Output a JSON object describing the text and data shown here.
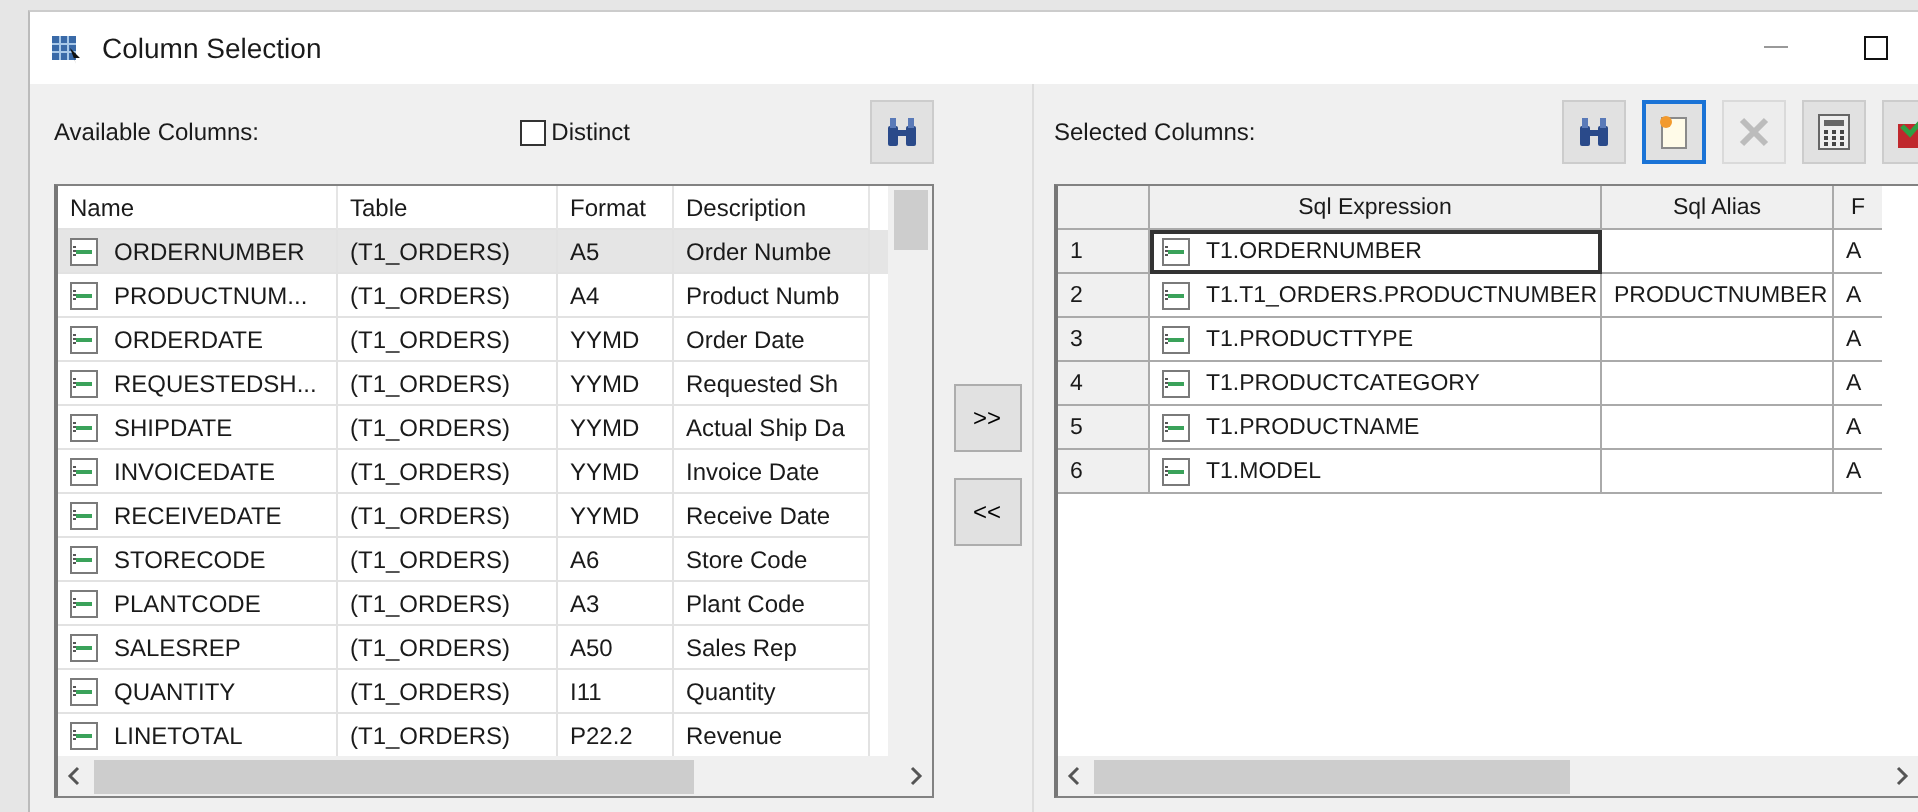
{
  "window": {
    "title": "Column Selection"
  },
  "available": {
    "label": "Available Columns:",
    "distinct": {
      "label": "Distinct",
      "checked": false
    },
    "columns": [
      "Name",
      "Table",
      "Format",
      "Description"
    ],
    "rows": [
      {
        "name": "ORDERNUMBER",
        "table": "(T1_ORDERS)",
        "format": "A5",
        "description": "Order Numbe",
        "selected": true
      },
      {
        "name": "PRODUCTNUM...",
        "table": "(T1_ORDERS)",
        "format": "A4",
        "description": "Product Numb",
        "selected": false
      },
      {
        "name": "ORDERDATE",
        "table": "(T1_ORDERS)",
        "format": "YYMD",
        "description": "Order Date",
        "selected": false
      },
      {
        "name": "REQUESTEDSH...",
        "table": "(T1_ORDERS)",
        "format": "YYMD",
        "description": "Requested Sh",
        "selected": false
      },
      {
        "name": "SHIPDATE",
        "table": "(T1_ORDERS)",
        "format": "YYMD",
        "description": "Actual Ship Da",
        "selected": false
      },
      {
        "name": "INVOICEDATE",
        "table": "(T1_ORDERS)",
        "format": "YYMD",
        "description": "Invoice Date",
        "selected": false
      },
      {
        "name": "RECEIVEDATE",
        "table": "(T1_ORDERS)",
        "format": "YYMD",
        "description": "Receive Date",
        "selected": false
      },
      {
        "name": "STORECODE",
        "table": "(T1_ORDERS)",
        "format": "A6",
        "description": "Store Code",
        "selected": false
      },
      {
        "name": "PLANTCODE",
        "table": "(T1_ORDERS)",
        "format": "A3",
        "description": "Plant Code",
        "selected": false
      },
      {
        "name": "SALESREP",
        "table": "(T1_ORDERS)",
        "format": "A50",
        "description": "Sales Rep",
        "selected": false
      },
      {
        "name": "QUANTITY",
        "table": "(T1_ORDERS)",
        "format": "I11",
        "description": "Quantity",
        "selected": false
      },
      {
        "name": "LINETOTAL",
        "table": "(T1_ORDERS)",
        "format": "P22.2",
        "description": "Revenue",
        "selected": false
      }
    ]
  },
  "move_buttons": [
    ">>",
    "<<"
  ],
  "selected": {
    "label": "Selected Columns:",
    "tools": [
      {
        "kind": "find",
        "focused": false,
        "disabled": false
      },
      {
        "kind": "new",
        "focused": true,
        "disabled": false
      },
      {
        "kind": "delete",
        "focused": false,
        "disabled": true
      },
      {
        "kind": "calculator",
        "focused": false,
        "disabled": false
      },
      {
        "kind": "sql",
        "focused": false,
        "disabled": false
      }
    ],
    "columns": [
      "Sql Expression",
      "Sql Alias",
      "F"
    ],
    "rows": [
      {
        "number": "1",
        "expression": "T1.ORDERNUMBER",
        "column_3": "A",
        "focused": true
      },
      {
        "number": "2",
        "expression": "T1.T1_ORDERS.PRODUCTNUMBER",
        "alias": "PRODUCTNUMBER",
        "column_3": "A",
        "focused": false
      },
      {
        "number": "3",
        "expression": "T1.PRODUCTTYPE",
        "column_3": "A",
        "focused": false
      },
      {
        "number": "4",
        "expression": "T1.PRODUCTCATEGORY",
        "column_3": "A",
        "focused": false
      },
      {
        "number": "5",
        "expression": "T1.PRODUCTNAME",
        "column_3": "A",
        "focused": false
      },
      {
        "number": "6",
        "expression": "T1.MODEL",
        "column_3": "A",
        "focused": false
      }
    ]
  }
}
